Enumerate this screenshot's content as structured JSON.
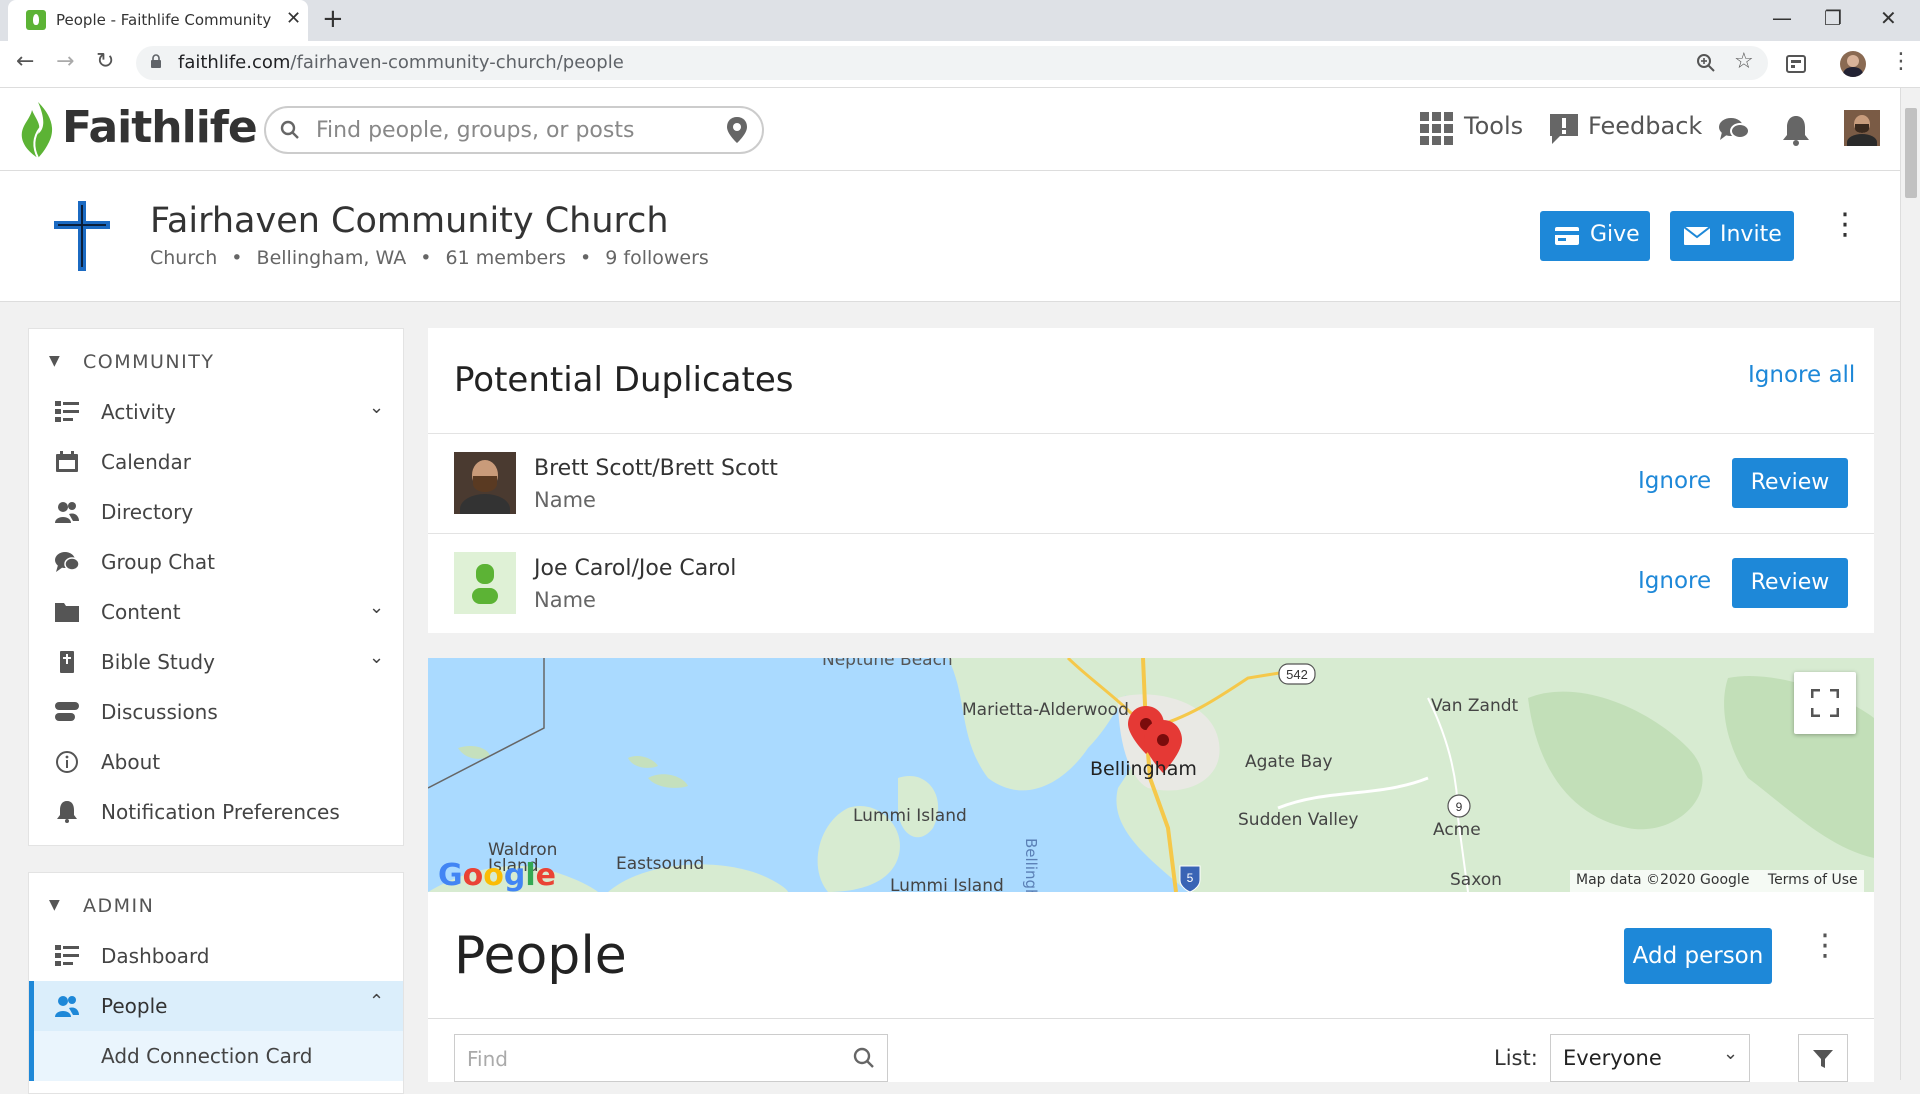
{
  "browser": {
    "tab_title": "People - Faithlife Community C",
    "url_domain": "faithlife.com",
    "url_path": "/fairhaven-community-church/people"
  },
  "header": {
    "logo_text": "Faithlife",
    "search_placeholder": "Find people, groups, or posts",
    "tools_label": "Tools",
    "feedback_label": "Feedback"
  },
  "church": {
    "name": "Fairhaven Community Church",
    "type": "Church",
    "location": "Bellingham, WA",
    "members": "61 members",
    "followers": "9 followers",
    "give_label": "Give",
    "invite_label": "Invite"
  },
  "sidebar": {
    "community_title": "COMMUNITY",
    "community_items": [
      {
        "label": "Activity",
        "icon": "activity-icon",
        "expandable": true
      },
      {
        "label": "Calendar",
        "icon": "calendar-icon",
        "expandable": false
      },
      {
        "label": "Directory",
        "icon": "people-icon",
        "expandable": false
      },
      {
        "label": "Group Chat",
        "icon": "chat-icon",
        "expandable": false
      },
      {
        "label": "Content",
        "icon": "folder-icon",
        "expandable": true
      },
      {
        "label": "Bible Study",
        "icon": "bible-icon",
        "expandable": true
      },
      {
        "label": "Discussions",
        "icon": "discussions-icon",
        "expandable": false
      },
      {
        "label": "About",
        "icon": "info-icon",
        "expandable": false
      },
      {
        "label": "Notification Preferences",
        "icon": "bell-icon",
        "expandable": false
      }
    ],
    "admin_title": "ADMIN",
    "admin_items": [
      {
        "label": "Dashboard",
        "icon": "activity-icon"
      },
      {
        "label": "People",
        "icon": "people-icon",
        "active": true
      },
      {
        "label": "Add Connection Card",
        "sub": true
      }
    ]
  },
  "duplicates": {
    "title": "Potential Duplicates",
    "ignore_all_label": "Ignore all",
    "rows": [
      {
        "name": "Brett Scott/Brett Scott",
        "field": "Name",
        "ignore_label": "Ignore",
        "review_label": "Review"
      },
      {
        "name": "Joe Carol/Joe Carol",
        "field": "Name",
        "ignore_label": "Ignore",
        "review_label": "Review"
      }
    ]
  },
  "map": {
    "labels": [
      "Neptune Beach",
      "Marietta-Alderwood",
      "Van Zandt",
      "Bellingham",
      "Agate Bay",
      "Lummi Island",
      "Sudden Valley",
      "Acme",
      "Waldron Island",
      "Eastsound",
      "Lummi Island",
      "Saxon",
      "Bellingham Bay"
    ],
    "road_labels": [
      "542",
      "9",
      "5"
    ],
    "attribution": "Map data ©2020 Google",
    "terms": "Terms of Use",
    "logo": "Google"
  },
  "people": {
    "title": "People",
    "add_person_label": "Add person",
    "find_placeholder": "Find",
    "list_label": "List:",
    "list_value": "Everyone"
  },
  "colors": {
    "accent_blue": "#1e88d8",
    "faithlife_green": "#5cb335",
    "map_water": "#aadaff",
    "map_land": "#d7ebd1"
  }
}
